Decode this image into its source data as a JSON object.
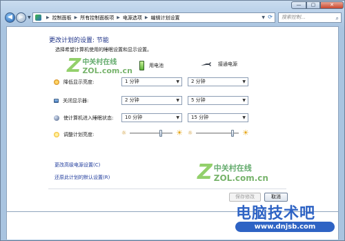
{
  "window": {
    "controls": {
      "minimize": "—",
      "maximize": "▢",
      "close": "✕"
    }
  },
  "navbar": {
    "breadcrumbs": [
      "控制面板",
      "所有控制面板项",
      "电源选项",
      "编辑计划设置"
    ],
    "search_placeholder": "搜索控制..."
  },
  "main": {
    "title": "更改计划的设置: 节能",
    "subtitle": "选择希望计算机使用的睡眠设置和显示设置。",
    "columns": {
      "battery": "用电池",
      "plugged": "接通电源"
    },
    "rows": [
      {
        "label": "降低显示亮度:",
        "icon": "dim-display-icon",
        "battery": "1 分钟",
        "plugged": "2 分钟"
      },
      {
        "label": "关闭显示器:",
        "icon": "monitor-icon",
        "battery": "2 分钟",
        "plugged": "5 分钟"
      },
      {
        "label": "使计算机进入睡眠状态:",
        "icon": "sleep-icon",
        "battery": "10 分钟",
        "plugged": "15 分钟"
      }
    ],
    "brightness": {
      "label": "调整计划亮度:",
      "battery_level": 0.72,
      "plugged_level": 0.85
    },
    "links": {
      "advanced": "更改高级电源设置(C)",
      "restore": "还原此计划的默认设置(R)"
    }
  },
  "footer": {
    "save_label": "保存修改",
    "cancel_label": "取消"
  },
  "watermarks": {
    "zol_cn": "中关村在线",
    "zol_url": "ZOL.com.cn",
    "site_cn": "电脑技术吧",
    "site_url": "www.dnjsb.com"
  },
  "colors": {
    "title_blue": "#1e3287",
    "link_blue": "#1f3b9c",
    "frame_blue": "#b7cfe8",
    "site_blue": "#2e63c4",
    "watermark_green": "#6fc13a"
  }
}
